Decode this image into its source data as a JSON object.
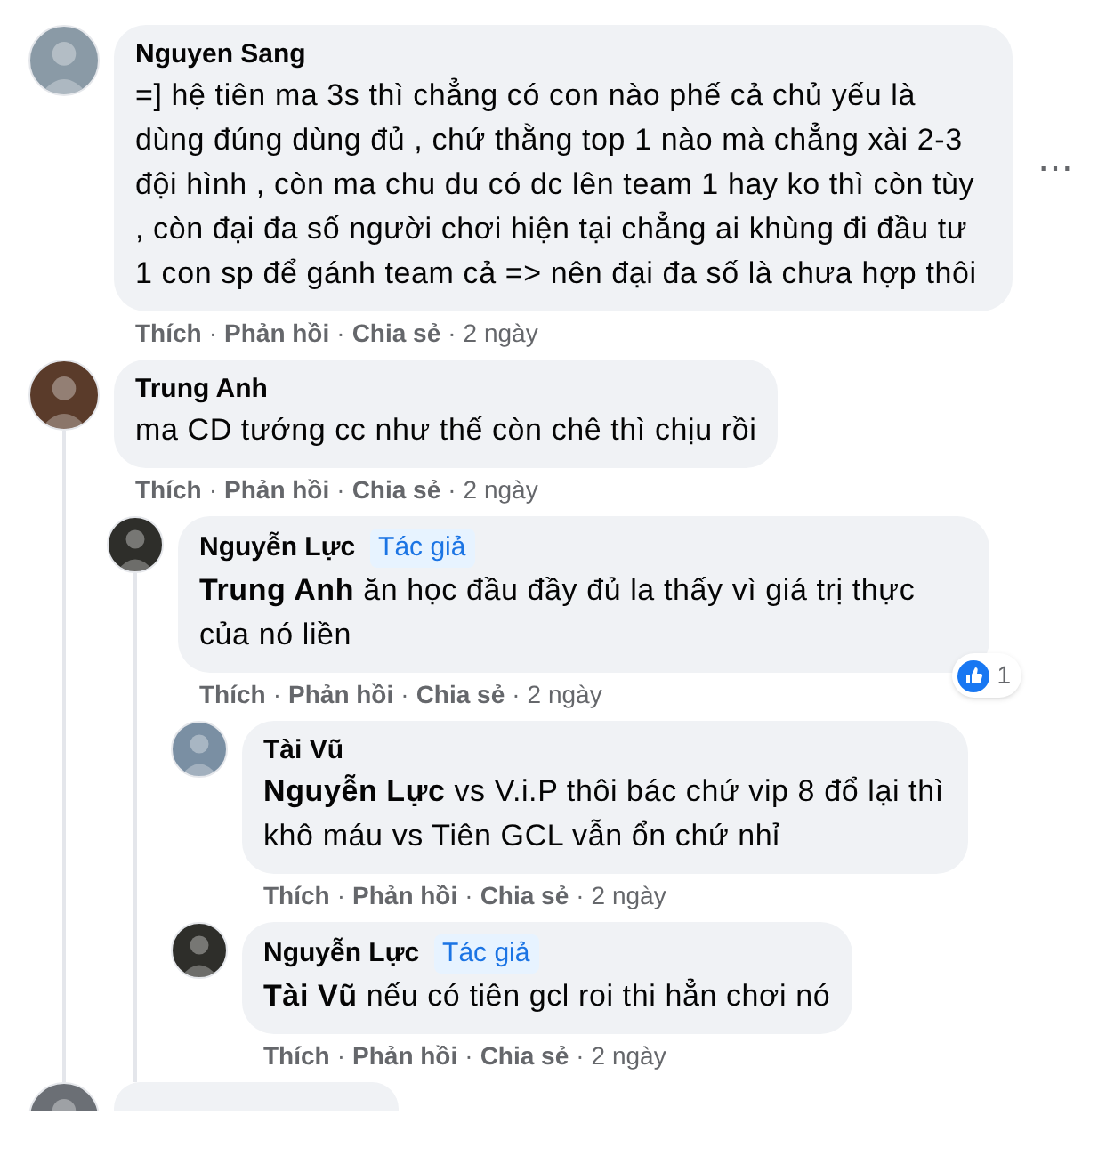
{
  "comments": [
    {
      "kind": "comment",
      "author": "Nguyen Sang",
      "text": "=] hệ tiên ma 3s thì chẳng có con nào phế cả chủ yếu là dùng đúng dùng đủ , chứ thằng top 1 nào mà chẳng xài 2-3 đội hình , còn ma chu du có dc lên team 1 hay ko thì còn tùy , còn đại đa số người chơi hiện tại chẳng ai khùng đi đầu tư 1 con sp để gánh team cả => nên đại đa số là chưa hợp thôi",
      "more_button": "⋯",
      "meta": [
        {
          "kind": "link",
          "text": "Thích"
        },
        {
          "kind": "sep",
          "text": "·"
        },
        {
          "kind": "link",
          "text": "Phản hồi"
        },
        {
          "kind": "sep",
          "text": "·"
        },
        {
          "kind": "link",
          "text": "Chia sẻ"
        },
        {
          "kind": "sep",
          "text": "·"
        },
        {
          "kind": "time",
          "text": "2 ngày"
        }
      ]
    },
    {
      "kind": "comment",
      "author": "Trung Anh",
      "text": "ma CD tướng cc như thế còn chê thì chịu rồi",
      "meta": [
        {
          "kind": "link",
          "text": "Thích"
        },
        {
          "kind": "sep",
          "text": "·"
        },
        {
          "kind": "link",
          "text": "Phản hồi"
        },
        {
          "kind": "sep",
          "text": "·"
        },
        {
          "kind": "link",
          "text": "Chia sẻ"
        },
        {
          "kind": "sep",
          "text": "·"
        },
        {
          "kind": "time",
          "text": "2 ngày"
        }
      ],
      "children": [
        {
          "kind": "comment",
          "author": "Nguyễn Lực",
          "badge": "Tác giả",
          "mention": "Trung Anh",
          "text": "ăn học đầu đầy đủ la thấy vì giá trị thực của nó liền",
          "reactions": "1",
          "meta": [
            {
              "kind": "link",
              "text": "Thích"
            },
            {
              "kind": "sep",
              "text": "·"
            },
            {
              "kind": "link",
              "text": "Phản hồi"
            },
            {
              "kind": "sep",
              "text": "·"
            },
            {
              "kind": "link",
              "text": "Chia sẻ"
            },
            {
              "kind": "sep",
              "text": "·"
            },
            {
              "kind": "time",
              "text": "2 ngày"
            }
          ],
          "children": [
            {
              "kind": "comment",
              "author": "Tài Vũ",
              "mention": "Nguyễn Lực",
              "text": "vs V.i.P thôi bác chứ vip 8 đổ lại thì khô máu vs Tiên GCL vẫn ổn chứ nhỉ",
              "meta": [
                {
                  "kind": "link",
                  "text": "Thích"
                },
                {
                  "kind": "sep",
                  "text": "·"
                },
                {
                  "kind": "link",
                  "text": "Phản hồi"
                },
                {
                  "kind": "sep",
                  "text": "·"
                },
                {
                  "kind": "link",
                  "text": "Chia sẻ"
                },
                {
                  "kind": "sep",
                  "text": "·"
                },
                {
                  "kind": "time",
                  "text": "2 ngày"
                }
              ]
            },
            {
              "kind": "comment",
              "author": "Nguyễn Lực",
              "badge": "Tác giả",
              "mention": "Tài Vũ",
              "text": "nếu có tiên gcl roi thi hẳn chơi nó",
              "meta": [
                {
                  "kind": "link",
                  "text": "Thích"
                },
                {
                  "kind": "sep",
                  "text": "·"
                },
                {
                  "kind": "link",
                  "text": "Phản hồi"
                },
                {
                  "kind": "sep",
                  "text": "·"
                },
                {
                  "kind": "link",
                  "text": "Chia sẻ"
                },
                {
                  "kind": "sep",
                  "text": "·"
                },
                {
                  "kind": "time",
                  "text": "2 ngày"
                }
              ]
            }
          ]
        }
      ]
    },
    {
      "kind": "cut_off"
    }
  ]
}
